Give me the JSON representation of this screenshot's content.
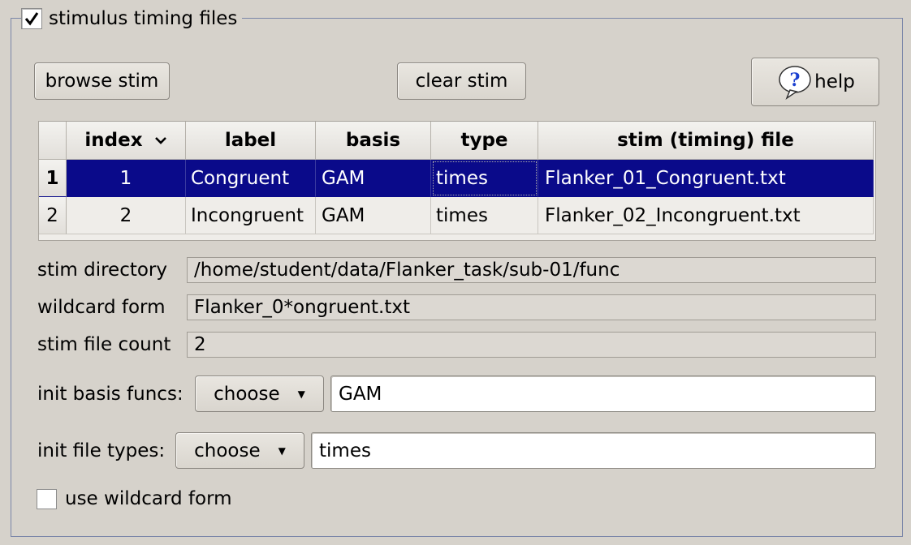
{
  "group": {
    "title": "stimulus timing files",
    "checked": true
  },
  "buttons": {
    "browse": "browse stim",
    "clear": "clear stim",
    "help": "help"
  },
  "table": {
    "headers": [
      "index",
      "label",
      "basis",
      "type",
      "stim (timing) file"
    ],
    "rows": [
      {
        "row": "1",
        "index": "1",
        "label": "Congruent",
        "basis": "GAM",
        "type": "times",
        "file": "Flanker_01_Congruent.txt",
        "selected": true
      },
      {
        "row": "2",
        "index": "2",
        "label": "Incongruent",
        "basis": "GAM",
        "type": "times",
        "file": "Flanker_02_Incongruent.txt",
        "selected": false
      }
    ]
  },
  "fields": {
    "stim_dir_label": "stim directory",
    "stim_dir_value": "/home/student/data/Flanker_task/sub-01/func",
    "wildcard_label": "wildcard form",
    "wildcard_value": "Flanker_0*ongruent.txt",
    "count_label": "stim file count",
    "count_value": "2",
    "basis_label": "init basis funcs:",
    "basis_choose": "choose",
    "basis_value": "GAM",
    "types_label": "init file types:",
    "types_choose": "choose",
    "types_value": "times",
    "use_wildcard_label": "use wildcard form"
  },
  "icons": {
    "sort": "chevron-down-icon",
    "help": "help-bubble-icon",
    "check": "checkmark-icon"
  },
  "colors": {
    "selection": "#0a0a8a",
    "background": "#d6d2cb"
  }
}
